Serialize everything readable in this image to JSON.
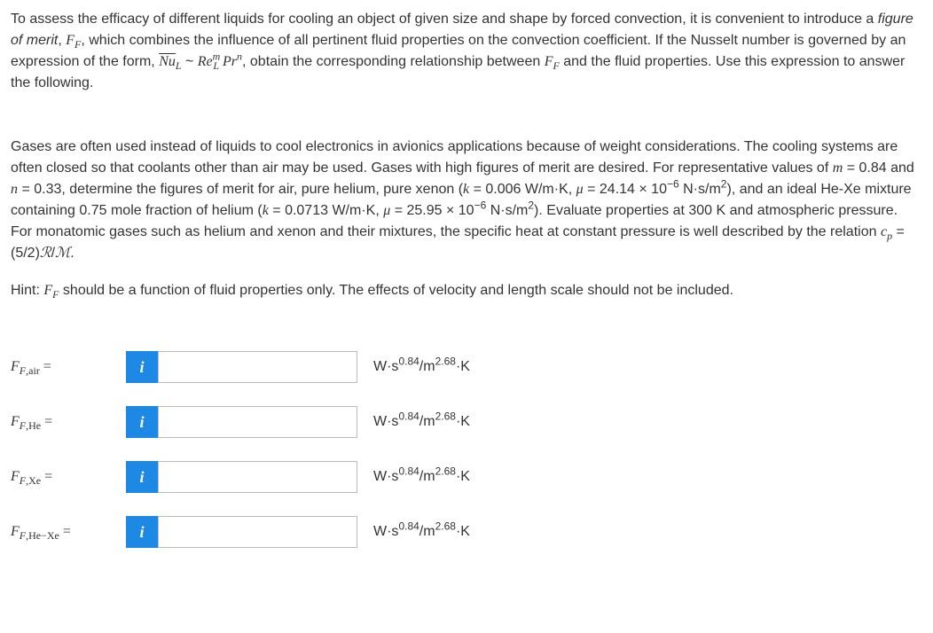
{
  "intro": {
    "p1_a": "To assess the efficacy of different liquids for cooling an object of given size and shape by forced convection, it is convenient to introduce a ",
    "p1_b": "figure of merit",
    "p1_c": ", ",
    "p1_d": "F",
    "p1_e": "F",
    "p1_f": ", which combines the influence of all pertinent fluid properties on the convection coefficient. If the Nusselt number is governed by an expression of the form, ",
    "p1_g": "Nu",
    "p1_h": "L",
    "p1_i": "  ~  ",
    "p1_j": "Re",
    "p1_k": "m",
    "p1_l": "L",
    "p1_m": " Pr",
    "p1_n": "n",
    "p1_o": ", obtain the corresponding relationship between ",
    "p1_p": "F",
    "p1_q": "F",
    "p1_r": " and the fluid properties. Use this expression to answer the following."
  },
  "body": {
    "p2_a": "Gases are often used instead of liquids to cool electronics in avionics applications because of weight considerations. The cooling systems are often closed so that coolants other than air may be used. Gases with high figures of merit are desired. For representative values of ",
    "p2_b": "m",
    "p2_c": "  =   0.84 and ",
    "p2_d": "n",
    "p2_e": "  =   0.33, determine the figures of merit for air, pure helium, pure xenon (",
    "p2_f": "k",
    "p2_g": "  =   0.006 W/m·K, ",
    "p2_h": "μ",
    "p2_i": "  =   24.14 × 10",
    "p2_j": "−6",
    "p2_k": " N·s/m",
    "p2_l": "2",
    "p2_m": "), and an ideal He-Xe mixture containing 0.75 mole fraction of helium (",
    "p2_n": "k",
    "p2_o": "  =   0.0713 W/m·K, ",
    "p2_p": "μ",
    "p2_q": "  =   25.95 × 10",
    "p2_r": "−6",
    "p2_s": " N·s/m",
    "p2_t": "2",
    "p2_u": "). Evaluate properties at 300 K and atmospheric pressure. For monatomic gases such as helium and xenon and their mixtures, the specific heat at constant pressure is well described by the relation ",
    "p2_v": "c",
    "p2_w": "p",
    "p2_x": "  =   (5/2)",
    "p2_y": "ℛ",
    "p2_z": "/",
    "p2_aa": "ℳ",
    "p2_bb": "."
  },
  "hint": {
    "a": "Hint: ",
    "b": "F",
    "c": "F",
    "d": " should be a function of fluid properties only. The effects of velocity and length scale should not be included."
  },
  "answers": [
    {
      "label_main": "F",
      "label_sub1": "F",
      "label_sub2": ",air",
      "equals": "  =",
      "unit": "W·s",
      "unit_sup1": "0.84",
      "unit_mid": "/m",
      "unit_sup2": "2.68",
      "unit_end": "·K"
    },
    {
      "label_main": "F",
      "label_sub1": "F",
      "label_sub2": ",He",
      "equals": "  =",
      "unit": "W·s",
      "unit_sup1": "0.84",
      "unit_mid": "/m",
      "unit_sup2": "2.68",
      "unit_end": "·K"
    },
    {
      "label_main": "F",
      "label_sub1": "F",
      "label_sub2": ",Xe",
      "equals": "  =",
      "unit": "W·s",
      "unit_sup1": "0.84",
      "unit_mid": "/m",
      "unit_sup2": "2.68",
      "unit_end": "·K"
    },
    {
      "label_main": "F",
      "label_sub1": "F",
      "label_sub2": ",He−Xe",
      "equals": "  =",
      "unit": "W·s",
      "unit_sup1": "0.84",
      "unit_mid": "/m",
      "unit_sup2": "2.68",
      "unit_end": "·K"
    }
  ],
  "info_icon": "i"
}
